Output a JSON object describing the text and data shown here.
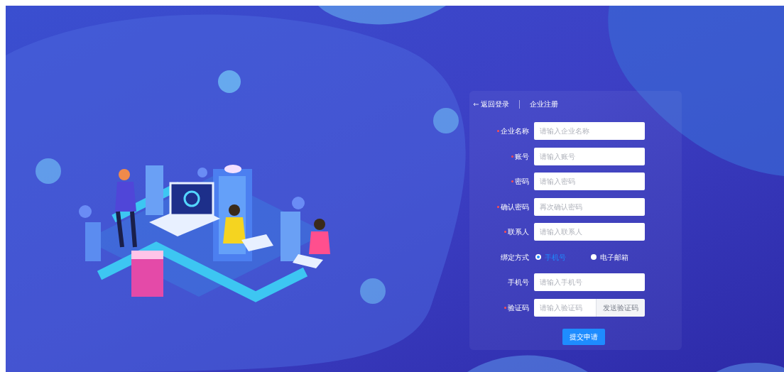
{
  "header": {
    "back_link": "返回登录",
    "title": "企业注册"
  },
  "fields": [
    {
      "kind": "input",
      "label": "企业名称",
      "required": true,
      "placeholder": "请输入企业名称"
    },
    {
      "kind": "input",
      "label": "账号",
      "required": true,
      "placeholder": "请输入账号"
    },
    {
      "kind": "input",
      "label": "密码",
      "required": true,
      "placeholder": "请输入密码"
    },
    {
      "kind": "input",
      "label": "确认密码",
      "required": true,
      "placeholder": "再次确认密码"
    },
    {
      "kind": "input",
      "label": "联系人",
      "required": true,
      "placeholder": "请输入联系人"
    },
    {
      "kind": "radio",
      "label": "绑定方式",
      "required": false,
      "options": [
        {
          "label": "手机号",
          "selected": true
        },
        {
          "label": "电子邮箱",
          "selected": false
        }
      ]
    },
    {
      "kind": "input",
      "label": "手机号",
      "required": false,
      "placeholder": "请输入手机号"
    },
    {
      "kind": "code",
      "label": "验证码",
      "required": true,
      "placeholder": "请输入验证码",
      "button": "发送验证码"
    }
  ],
  "submit": "提交申请"
}
